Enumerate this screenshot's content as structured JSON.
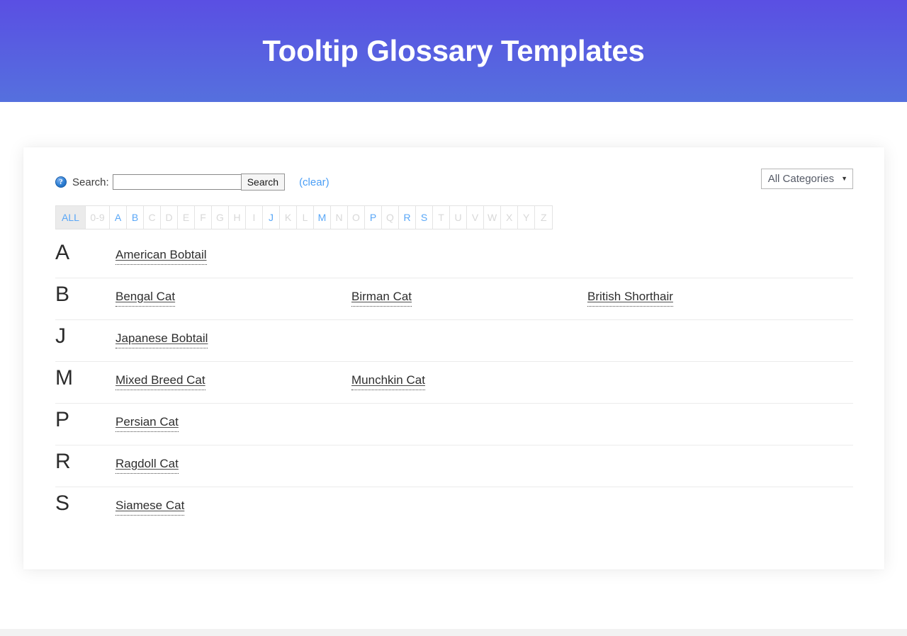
{
  "header": {
    "title": "Tooltip Glossary Templates",
    "gradient_top": "#5a4fe3",
    "gradient_bottom": "#5570de"
  },
  "toolbar": {
    "help_icon_glyph": "?",
    "search_label": "Search:",
    "search_value": "",
    "search_placeholder": "",
    "search_button_label": "Search",
    "clear_label": "(clear)",
    "clear_color": "#4a9ef6",
    "category_selected": "All Categories",
    "category_caret": "▼"
  },
  "alphabet": {
    "current": "ALL",
    "cells": [
      {
        "label": "ALL",
        "state": "current"
      },
      {
        "label": "0-9",
        "state": "inactive"
      },
      {
        "label": "A",
        "state": "active"
      },
      {
        "label": "B",
        "state": "active"
      },
      {
        "label": "C",
        "state": "inactive"
      },
      {
        "label": "D",
        "state": "inactive"
      },
      {
        "label": "E",
        "state": "inactive"
      },
      {
        "label": "F",
        "state": "inactive"
      },
      {
        "label": "G",
        "state": "inactive"
      },
      {
        "label": "H",
        "state": "inactive"
      },
      {
        "label": "I",
        "state": "inactive"
      },
      {
        "label": "J",
        "state": "active"
      },
      {
        "label": "K",
        "state": "inactive"
      },
      {
        "label": "L",
        "state": "inactive"
      },
      {
        "label": "M",
        "state": "active"
      },
      {
        "label": "N",
        "state": "inactive"
      },
      {
        "label": "O",
        "state": "inactive"
      },
      {
        "label": "P",
        "state": "active"
      },
      {
        "label": "Q",
        "state": "inactive"
      },
      {
        "label": "R",
        "state": "active"
      },
      {
        "label": "S",
        "state": "active"
      },
      {
        "label": "T",
        "state": "inactive"
      },
      {
        "label": "U",
        "state": "inactive"
      },
      {
        "label": "V",
        "state": "inactive"
      },
      {
        "label": "W",
        "state": "inactive"
      },
      {
        "label": "X",
        "state": "inactive"
      },
      {
        "label": "Y",
        "state": "inactive"
      },
      {
        "label": "Z",
        "state": "inactive"
      }
    ]
  },
  "glossary": {
    "groups": [
      {
        "letter": "A",
        "terms": [
          "American Bobtail"
        ]
      },
      {
        "letter": "B",
        "terms": [
          "Bengal Cat",
          "Birman Cat",
          "British Shorthair"
        ]
      },
      {
        "letter": "J",
        "terms": [
          "Japanese Bobtail"
        ]
      },
      {
        "letter": "M",
        "terms": [
          "Mixed Breed Cat",
          "Munchkin Cat"
        ]
      },
      {
        "letter": "P",
        "terms": [
          "Persian Cat"
        ]
      },
      {
        "letter": "R",
        "terms": [
          "Ragdoll Cat"
        ]
      },
      {
        "letter": "S",
        "terms": [
          "Siamese Cat"
        ]
      }
    ]
  }
}
